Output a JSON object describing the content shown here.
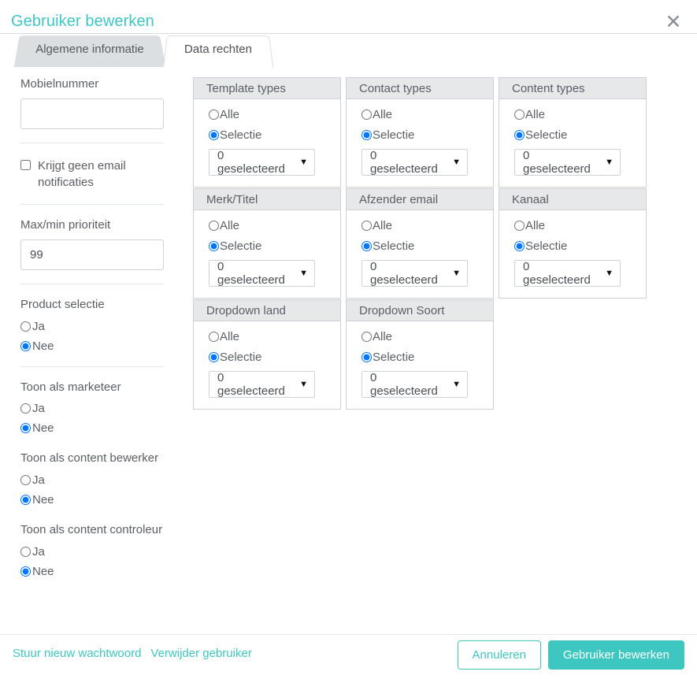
{
  "modal": {
    "title": "Gebruiker bewerken",
    "close_icon": "close-icon",
    "close_glyph": "✕"
  },
  "tabs": [
    {
      "label": "Algemene informatie",
      "active": false
    },
    {
      "label": "Data rechten",
      "active": true
    }
  ],
  "left_column": {
    "mobile": {
      "label": "Mobielnummer",
      "value": "",
      "placeholder": ""
    },
    "email_notifications": {
      "label": "Krijgt geen email notificaties",
      "checked": false
    },
    "priority": {
      "label": "Max/min prioriteit",
      "value": "99"
    },
    "radio_groups": [
      {
        "title": "Product selectie",
        "options": [
          "Ja",
          "Nee"
        ],
        "selected": "Nee"
      },
      {
        "title": "Toon als marketeer",
        "options": [
          "Ja",
          "Nee"
        ],
        "selected": "Nee"
      },
      {
        "title": "Toon als content bewerker",
        "options": [
          "Ja",
          "Nee"
        ],
        "selected": "Nee"
      },
      {
        "title": "Toon als content controleur",
        "options": [
          "Ja",
          "Nee"
        ],
        "selected": "Nee"
      }
    ]
  },
  "panels": [
    {
      "title": "Template types",
      "options": [
        "Alle",
        "Selectie"
      ],
      "selected": "Selectie",
      "dropdown_value": "0 geselecteerd",
      "arrow_glyph": "▼"
    },
    {
      "title": "Contact types",
      "options": [
        "Alle",
        "Selectie"
      ],
      "selected": "Selectie",
      "dropdown_value": "0 geselecteerd",
      "arrow_glyph": "▼"
    },
    {
      "title": "Content types",
      "options": [
        "Alle",
        "Selectie"
      ],
      "selected": "Selectie",
      "dropdown_value": "0 geselecteerd",
      "arrow_glyph": "▼"
    },
    {
      "title": "Merk/Titel",
      "options": [
        "Alle",
        "Selectie"
      ],
      "selected": "Selectie",
      "dropdown_value": "0 geselecteerd",
      "arrow_glyph": "▼"
    },
    {
      "title": "Afzender email",
      "options": [
        "Alle",
        "Selectie"
      ],
      "selected": "Selectie",
      "dropdown_value": "0 geselecteerd",
      "arrow_glyph": "▼"
    },
    {
      "title": "Kanaal",
      "options": [
        "Alle",
        "Selectie"
      ],
      "selected": "Selectie",
      "dropdown_value": "0 geselecteerd",
      "arrow_glyph": "▼"
    },
    {
      "title": "Dropdown land",
      "options": [
        "Alle",
        "Selectie"
      ],
      "selected": "Selectie",
      "dropdown_value": "0 geselecteerd",
      "arrow_glyph": "▼"
    },
    {
      "title": "Dropdown Soort",
      "options": [
        "Alle",
        "Selectie"
      ],
      "selected": "Selectie",
      "dropdown_value": "0 geselecteerd",
      "arrow_glyph": "▼"
    }
  ],
  "footer": {
    "links": [
      {
        "label": "Stuur nieuw wachtwoord"
      },
      {
        "label": "Verwijder gebruiker"
      }
    ],
    "cancel_label": "Annuleren",
    "submit_label": "Gebruiker bewerken"
  },
  "colors": {
    "accent": "#3ec6c0",
    "text": "#5a5f66",
    "panel_header_bg": "#e6e8ea",
    "border": "#cdd1d5",
    "tab_inactive_bg": "#dcdfe2"
  }
}
